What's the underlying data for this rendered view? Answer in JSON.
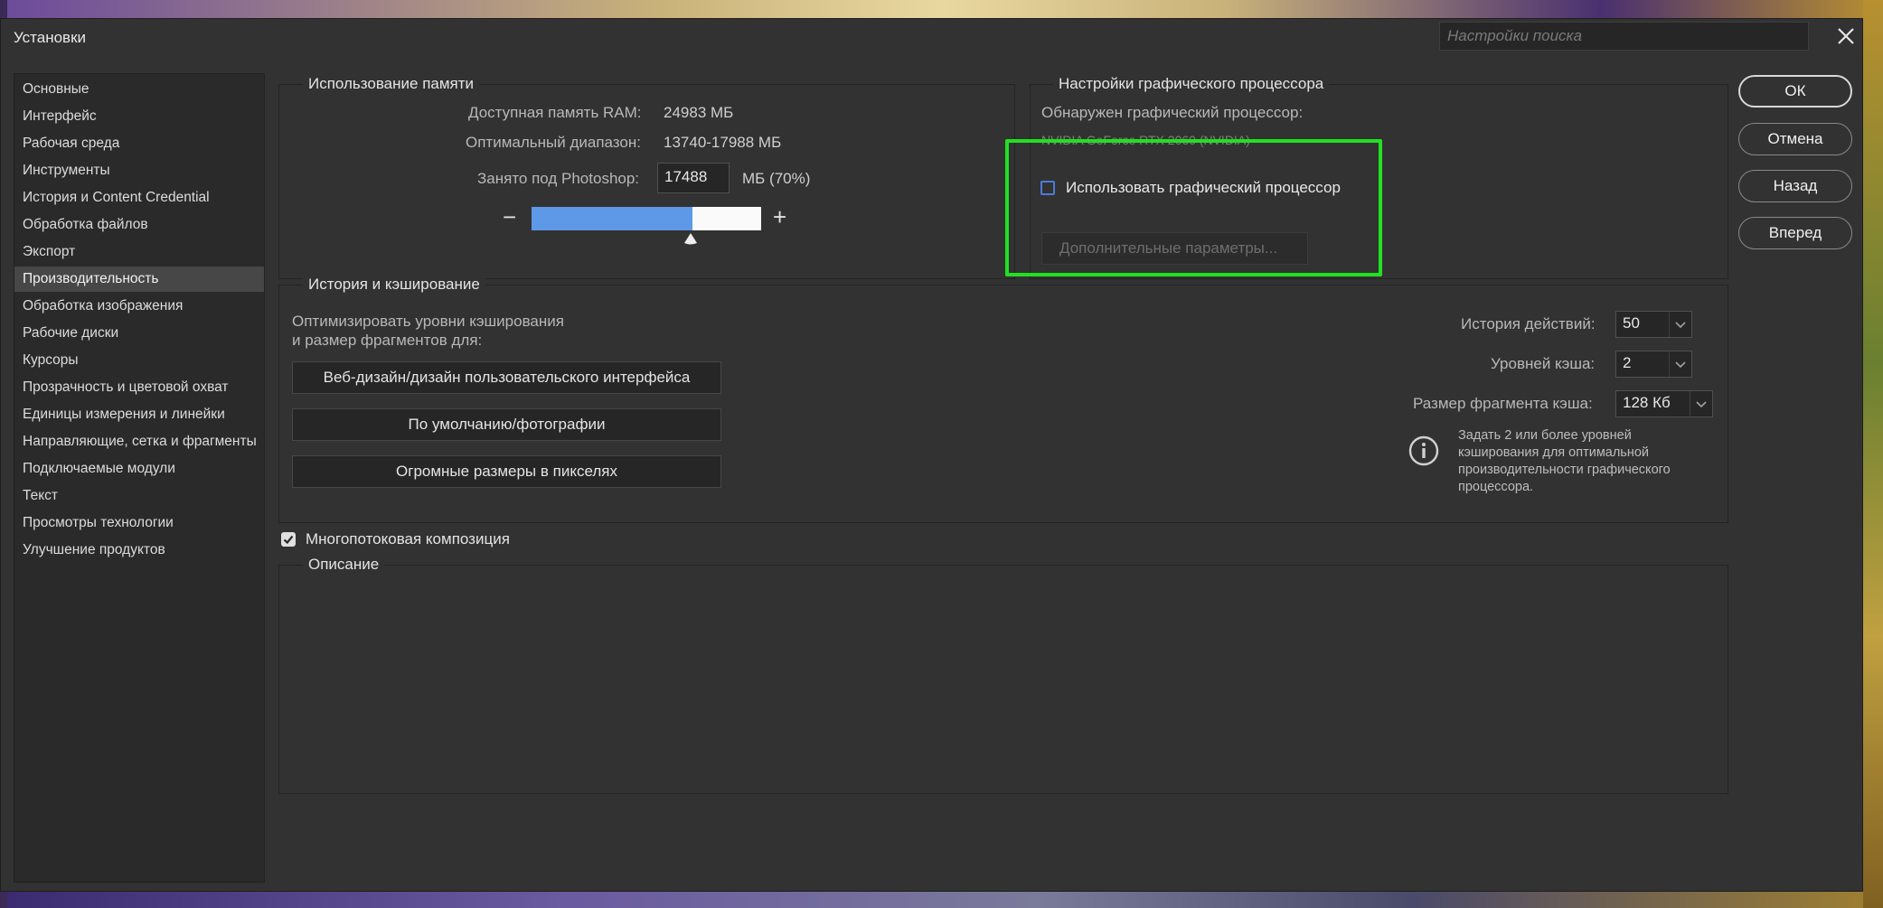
{
  "window": {
    "title": "Установки",
    "search_placeholder": "Настройки поиска"
  },
  "sidebar": {
    "items": [
      {
        "label": "Основные"
      },
      {
        "label": "Интерфейс"
      },
      {
        "label": "Рабочая среда"
      },
      {
        "label": "Инструменты"
      },
      {
        "label": "История и Content Credential"
      },
      {
        "label": "Обработка файлов"
      },
      {
        "label": "Экспорт"
      },
      {
        "label": "Производительность",
        "active": true
      },
      {
        "label": "Обработка изображения"
      },
      {
        "label": "Рабочие диски"
      },
      {
        "label": "Курсоры"
      },
      {
        "label": "Прозрачность и цветовой охват"
      },
      {
        "label": "Единицы измерения и линейки"
      },
      {
        "label": "Направляющие, сетка и фрагменты"
      },
      {
        "label": "Подключаемые модули"
      },
      {
        "label": "Текст"
      },
      {
        "label": "Просмотры технологии"
      },
      {
        "label": "Улучшение продуктов"
      }
    ]
  },
  "memory": {
    "title": "Использование памяти",
    "ram_label": "Доступная память RAM:",
    "ram_value": "24983 МБ",
    "range_label": "Оптимальный диапазон:",
    "range_value": "13740-17988 МБ",
    "used_label": "Занято под Photoshop:",
    "used_value": "17488",
    "used_unit": "МБ (70%)",
    "used_fraction": 0.7,
    "minus": "−",
    "plus": "+"
  },
  "gpu": {
    "title": "Настройки графического процессора",
    "detected_label": "Обнаружен графический процессор:",
    "detected_value": "NVIDIA GeForce RTX 2060 (NVIDIA)",
    "use_gpu_label": "Использовать графический процессор",
    "use_gpu_checked": false,
    "advanced_label": "Дополнительные параметры..."
  },
  "history": {
    "title": "История и кэширование",
    "optimize_text_1": "Оптимизировать уровни кэширования",
    "optimize_text_2": "и размер фрагментов для:",
    "preset_buttons": [
      "Веб-дизайн/дизайн пользовательского интерфейса",
      "По умолчанию/фотографии",
      "Огромные размеры в пикселях"
    ],
    "history_states_label": "История действий:",
    "history_states_value": "50",
    "cache_levels_label": "Уровней кэша:",
    "cache_levels_value": "2",
    "tile_size_label": "Размер фрагмента кэша:",
    "tile_size_value": "128 Кб",
    "info_text": "Задать 2 или более уровней кэширования для оптимальной производительности графического процессора."
  },
  "multithread": {
    "label": "Многопотоковая композиция",
    "checked": true
  },
  "description": {
    "title": "Описание"
  },
  "buttons": {
    "ok": "ОК",
    "cancel": "Отмена",
    "back": "Назад",
    "forward": "Вперед"
  },
  "colors": {
    "slider_fill": "#5e99e8",
    "highlight": "#22e022",
    "dialog_bg": "#323232"
  }
}
